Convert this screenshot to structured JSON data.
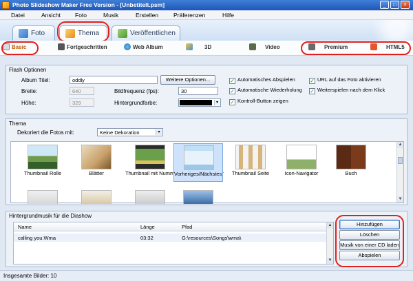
{
  "window": {
    "title": "Photo Slideshow Maker Free Version - [Unbetitelt.psm]",
    "controls": [
      "_",
      "□",
      "×"
    ]
  },
  "menu": [
    "Datei",
    "Ansicht",
    "Foto",
    "Musik",
    "Erstellen",
    "Präferenzen",
    "Hilfe"
  ],
  "main_tabs": [
    {
      "label": "Foto",
      "icon": "photo-icon"
    },
    {
      "label": "Thema",
      "icon": "theme-icon",
      "active": true
    },
    {
      "label": "Veröffentlichen",
      "icon": "publish-icon"
    }
  ],
  "sub_tabs": [
    {
      "label": "Basic",
      "icon": "basic-icon",
      "active": true
    },
    {
      "label": "Fortgeschritten",
      "icon": "camera-icon"
    },
    {
      "label": "Web Album",
      "icon": "globe-icon"
    },
    {
      "label": "3D",
      "icon": "3d-icon"
    },
    {
      "label": "Video",
      "icon": "film-icon"
    },
    {
      "label": "Premium",
      "icon": "premium-icon"
    },
    {
      "label": "HTML5",
      "icon": "html5-icon"
    }
  ],
  "flash": {
    "group_title": "Flash Optionen",
    "album_title_label": "Album Titel:",
    "album_title_value": "oddly",
    "more_options": "Weitere Optionen...",
    "width_label": "Breite:",
    "width_value": "640",
    "height_label": "Höhe:",
    "height_value": "329",
    "fps_label": "Bildfrequenz (fps):",
    "fps_value": "30",
    "bg_color_label": "Hintergrundfarbe:",
    "bg_color": "#000000",
    "checkboxes": [
      {
        "label": "Automatisches Abspielen",
        "checked": true
      },
      {
        "label": "Automatische Wiederholung",
        "checked": true
      },
      {
        "label": "Kontroll-Button zeigen",
        "checked": true
      },
      {
        "label": "URL auf das Foto aktivieren",
        "checked": true
      },
      {
        "label": "Weiterspielen nach dem Klick",
        "checked": true
      }
    ]
  },
  "theme": {
    "group_title": "Thema",
    "decorate_label": "Dekoriert die Fotos mit:",
    "decorate_value": "Keine Dekoration",
    "items": [
      "Thumbnail Rolle",
      "Blätter",
      "Thumbnail mit Nummer",
      "Vorheriges/Nächstes Thumb",
      "Thumbnail Seite",
      "Icon-Navigator",
      "Buch"
    ],
    "selected_index": 3
  },
  "music": {
    "group_title": "Hintergrundmusik für die Diashow",
    "columns": [
      "Name",
      "Länge",
      "Pfad"
    ],
    "rows": [
      {
        "name": "calling you.Wma",
        "length": "03:32",
        "path": "G:\\resources\\Songs\\wma\\"
      }
    ],
    "buttons": [
      "Hinzufügen",
      "Löschen",
      "Musik von einer CD laden",
      "Abspielen"
    ]
  },
  "status": {
    "total_images": "Insgesamte Bilder: 10"
  },
  "colors": {
    "highlight": "#e0201c",
    "active_subtab": "#c05a00"
  }
}
